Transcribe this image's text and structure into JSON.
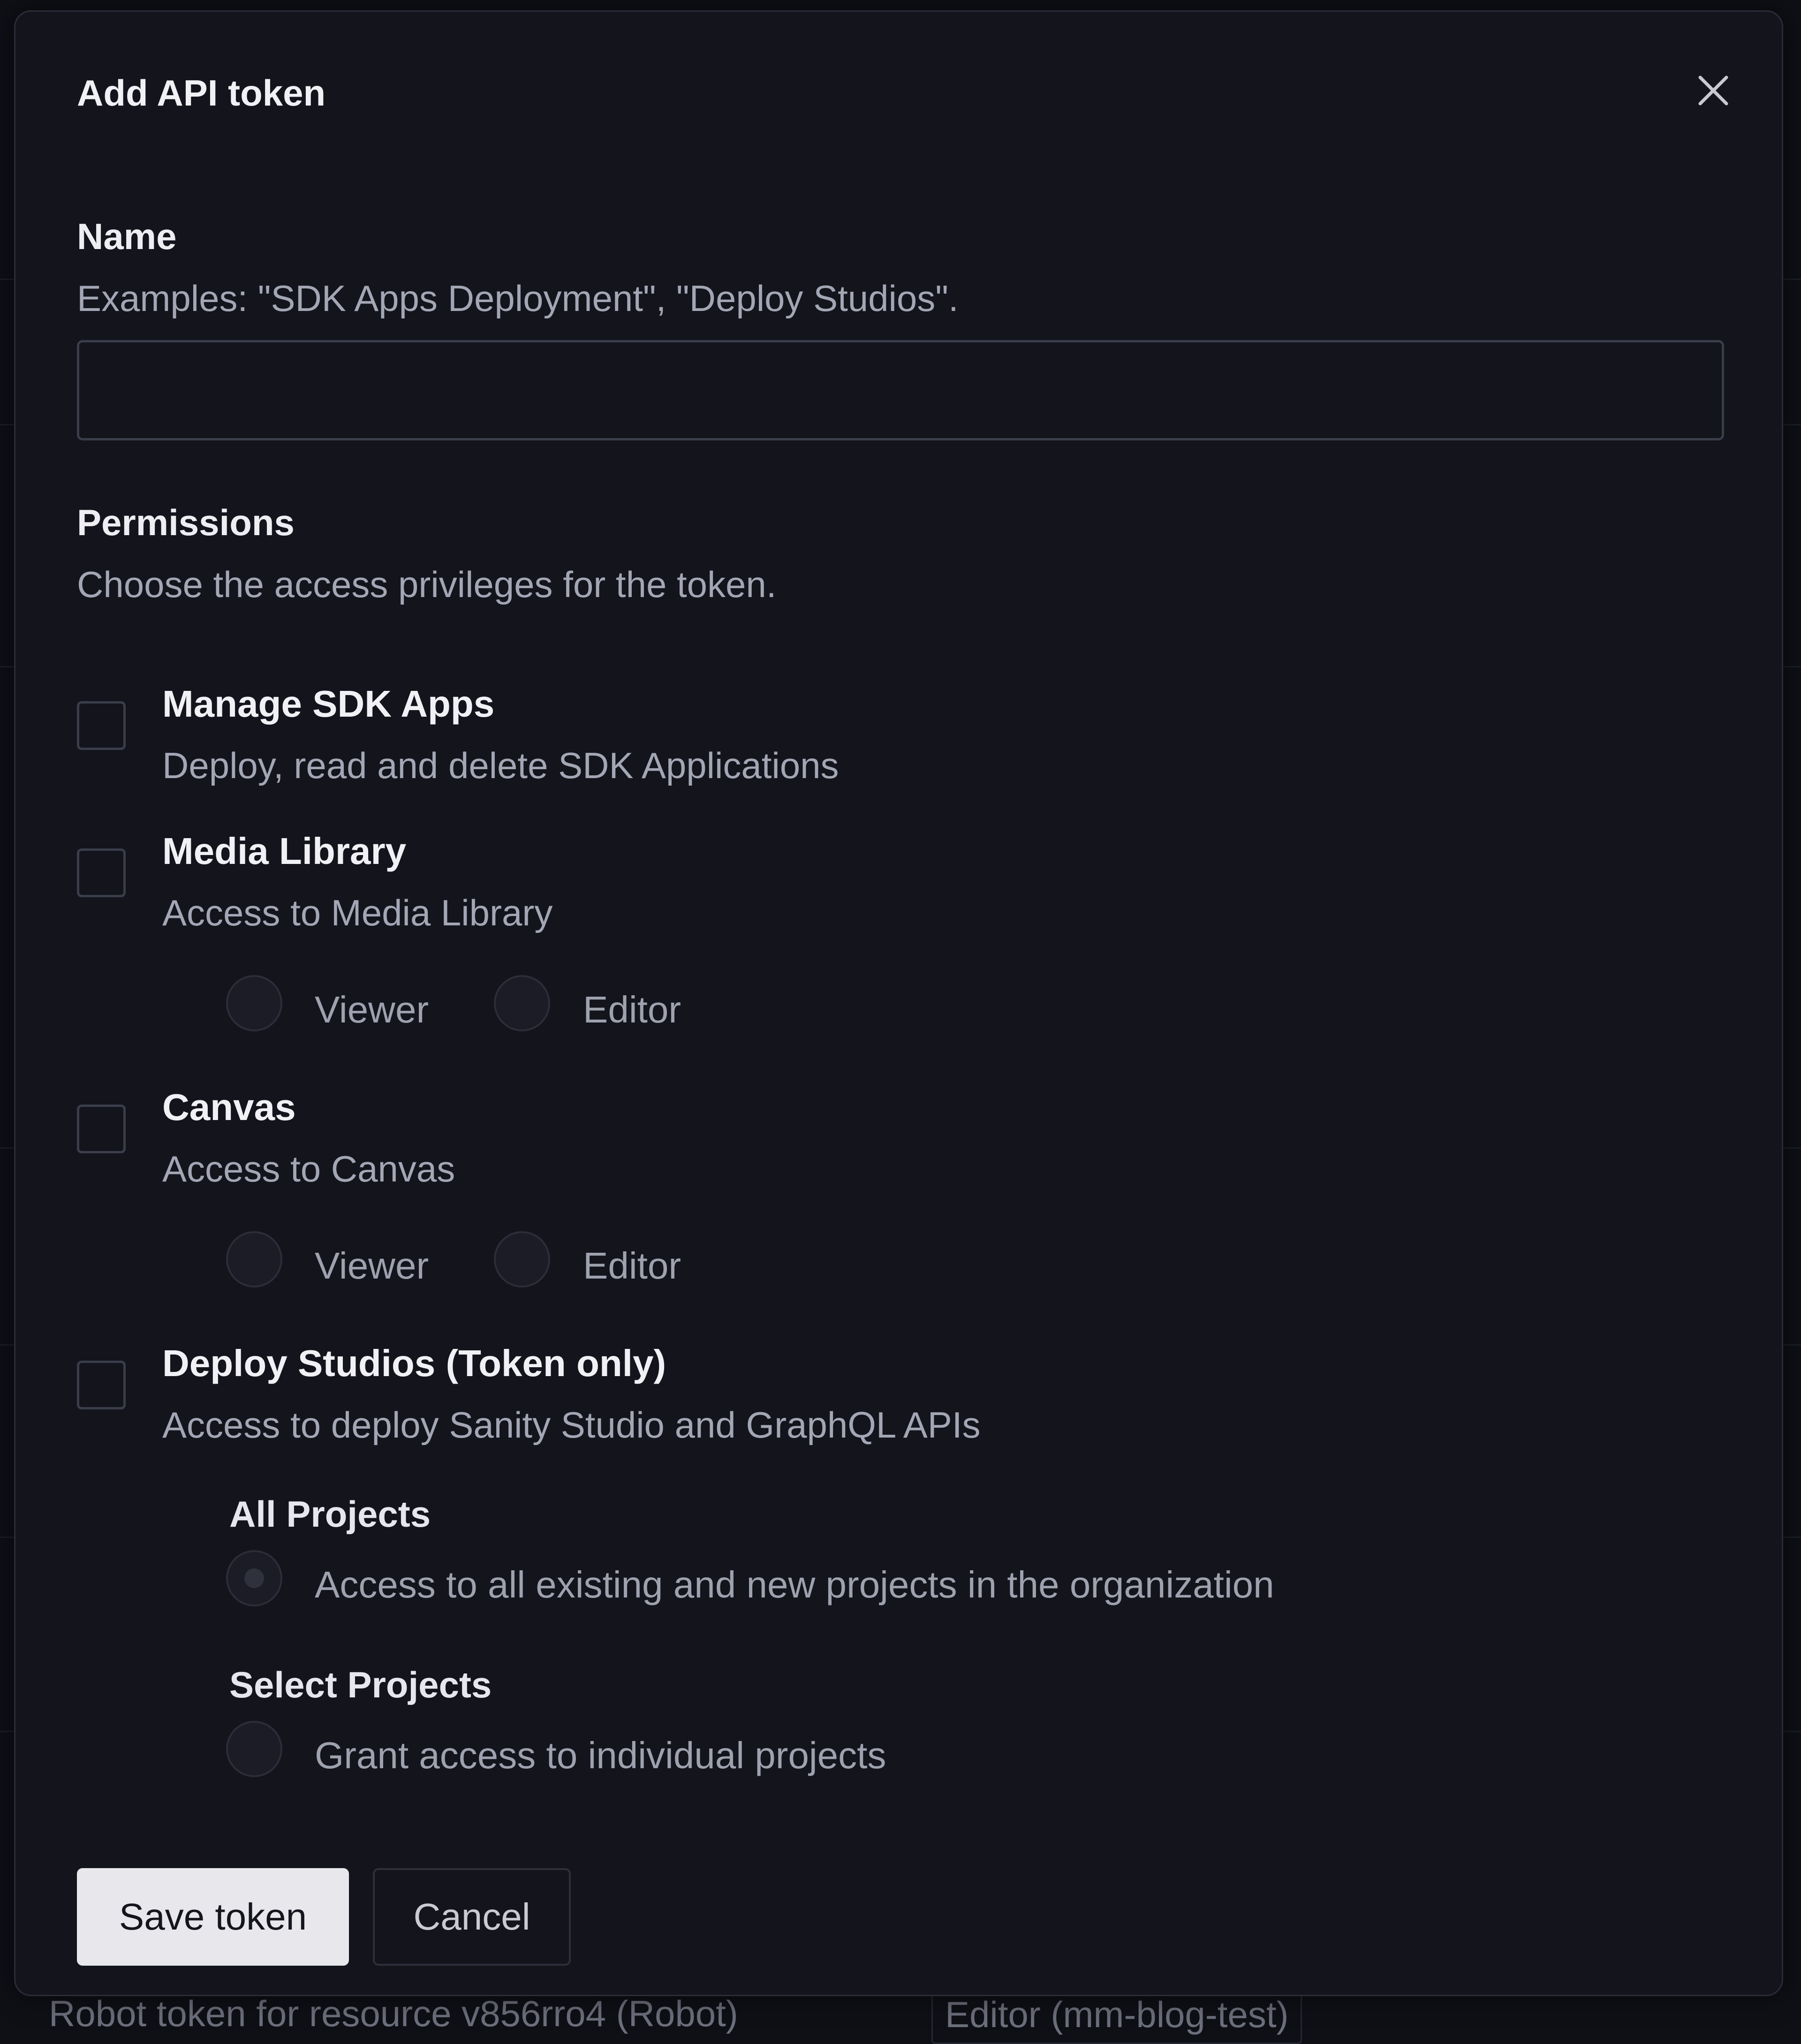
{
  "dialog": {
    "title": "Add API token",
    "close_icon": "close-icon"
  },
  "name_field": {
    "label": "Name",
    "hint": "Examples: \"SDK Apps Deployment\", \"Deploy Studios\".",
    "value": "",
    "placeholder": ""
  },
  "permissions": {
    "label": "Permissions",
    "hint": "Choose the access privileges for the token.",
    "items": [
      {
        "title": "Manage SDK Apps",
        "description": "Deploy, read and delete SDK Applications",
        "checked": false
      },
      {
        "title": "Media Library",
        "description": "Access to Media Library",
        "checked": false,
        "roles": [
          {
            "label": "Viewer",
            "selected": false
          },
          {
            "label": "Editor",
            "selected": false
          }
        ]
      },
      {
        "title": "Canvas",
        "description": "Access to Canvas",
        "checked": false,
        "roles": [
          {
            "label": "Viewer",
            "selected": false
          },
          {
            "label": "Editor",
            "selected": false
          }
        ]
      },
      {
        "title": "Deploy Studios (Token only)",
        "description": "Access to deploy Sanity Studio and GraphQL APIs",
        "checked": false,
        "scopes": [
          {
            "heading": "All Projects",
            "description": "Access to all existing and new projects in the organization",
            "selected": true
          },
          {
            "heading": "Select Projects",
            "description": "Grant access to individual projects",
            "selected": false
          }
        ]
      }
    ]
  },
  "actions": {
    "save_label": "Save token",
    "cancel_label": "Cancel"
  },
  "background": {
    "row_text": "Robot token for resource v856rro4 (Robot)",
    "row_badge": "Editor (mm-blog-test)"
  },
  "colors": {
    "page_background": "#0f1016",
    "modal_background": "#13141c",
    "primary_button": "#e8e8ec",
    "text_primary": "#ededf2",
    "text_muted": "#a3a6b4"
  }
}
